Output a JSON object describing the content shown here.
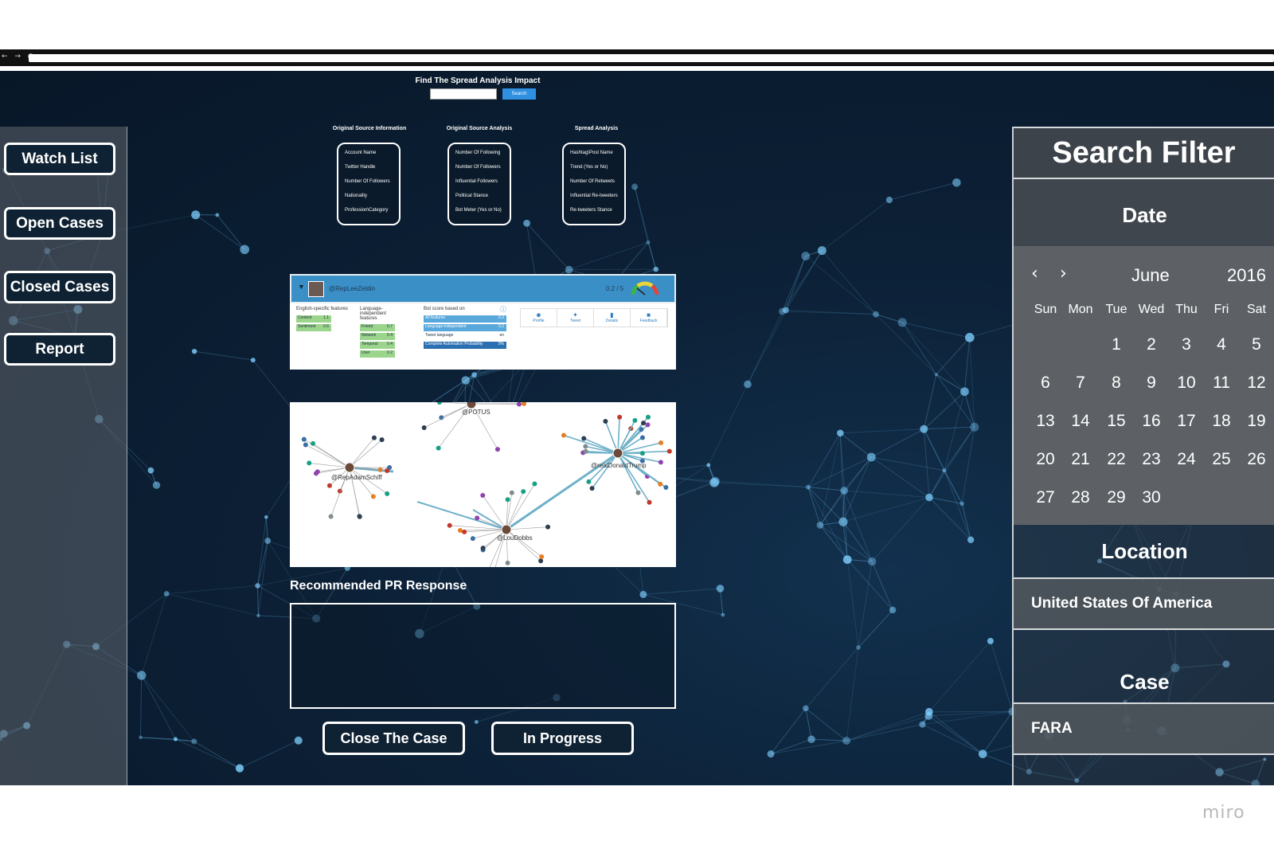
{
  "browser": {
    "nav_glyphs": "← → ○"
  },
  "header": {
    "title": "Find The Spread Analysis Impact",
    "search_value": "",
    "search_button": "Search"
  },
  "sidebar": {
    "items": [
      {
        "label": "Watch List"
      },
      {
        "label": "Open Cases"
      },
      {
        "label": "Closed Cases"
      },
      {
        "label": "Report"
      }
    ]
  },
  "columns": [
    {
      "title": "Original Source Information",
      "items": [
        "Account Name",
        "Twitter Handle",
        "Number Of Followers",
        "Nationality",
        "Profession\\Category"
      ]
    },
    {
      "title": "Original Source Analysis",
      "items": [
        "Number Of Following",
        "Number Of Followers",
        "Influential Followers",
        "Political Stance",
        "Bot Meter (Yes or No)"
      ]
    },
    {
      "title": "Spread Analysis",
      "items": [
        "Hashtag\\Post Name",
        "Trend (Yes or No)",
        "Number Of Retweets",
        "Influential Re-tweeters",
        "Re-tweeters Stance"
      ]
    }
  ],
  "botometer": {
    "handle": "@RepLeeZeldin",
    "score": "0.2 / 5",
    "english_label": "English-specific features",
    "language_label": "Language-independent features",
    "bot_label": "Bot score based on",
    "english": [
      {
        "k": "Content",
        "v": "1.1"
      },
      {
        "k": "Sentiment",
        "v": "0.6"
      }
    ],
    "language": [
      {
        "k": "Friend",
        "v": "0.7"
      },
      {
        "k": "Network",
        "v": "0.4"
      },
      {
        "k": "Temporal",
        "v": "0.4"
      },
      {
        "k": "User",
        "v": "0.2"
      }
    ],
    "bot": [
      {
        "k": "All features",
        "v": "0.2"
      },
      {
        "k": "Language-independent",
        "v": "0.2"
      },
      {
        "k": "Tweet language",
        "v": "en"
      },
      {
        "k": "Complete Automation Probability",
        "v": "0%"
      }
    ],
    "tabs": [
      "Profile",
      "Tweet",
      "Details",
      "Feedback"
    ]
  },
  "graph": {
    "hubs": [
      "@RepAdamSchiff",
      "@POTUS",
      "@realDonaldTrump",
      "@LouDobbs"
    ]
  },
  "pr": {
    "label": "Recommended PR Response",
    "value": ""
  },
  "actions": {
    "close": "Close The Case",
    "progress": "In Progress"
  },
  "filter": {
    "title": "Search Filter",
    "date_label": "Date",
    "month": "June",
    "year": "2016",
    "weekdays": [
      "Sun",
      "Mon",
      "Tue",
      "Wed",
      "Thu",
      "Fri",
      "Sat"
    ],
    "first_weekday": 2,
    "days_in_month": 30,
    "location_label": "Location",
    "location_value": "United States Of America",
    "case_label": "Case",
    "case_value": "FARA"
  },
  "watermark": "miro",
  "colors": {
    "accent": "#2f8fe0",
    "stage": "#0c2036",
    "panel": "#5d6166"
  }
}
